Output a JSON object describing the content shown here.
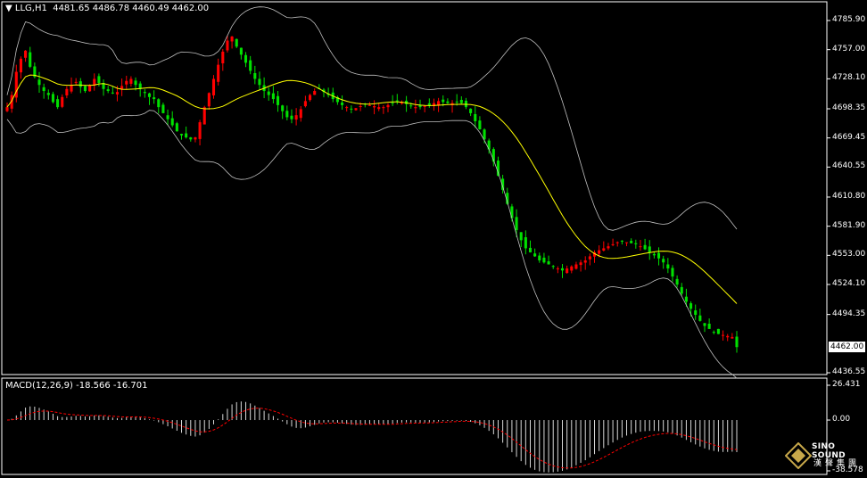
{
  "header": {
    "symbol": "LLG,H1",
    "ohlc": "4481.65 4486.78 4460.49 4462.00",
    "macd_label": "MACD(12,26,9) -18.566 -16.701"
  },
  "price_axis": {
    "ticks": [
      "4785.90",
      "4757.00",
      "4728.10",
      "4698.35",
      "4669.45",
      "4640.55",
      "4610.80",
      "4581.90",
      "4553.00",
      "4524.10",
      "4494.35",
      "4436.55"
    ],
    "current_price": "4462.00"
  },
  "macd_axis": {
    "ticks": [
      "26.431",
      "0.00",
      "-38.578"
    ]
  },
  "logo": {
    "en": "SINO SOUND",
    "cn": "漢聲集團"
  },
  "colors": {
    "up": "#ff0000",
    "down": "#00e000",
    "ma": "#ffff00",
    "bands": "#c0c0c0",
    "signal": "#ff0000"
  },
  "chart_data": [
    {
      "type": "candlestick",
      "title": "LLG,H1",
      "ylim": [
        4430,
        4800
      ],
      "overlays": [
        "Bollinger Bands",
        "Moving Average"
      ],
      "close": [
        4700,
        4712,
        4735,
        4748,
        4756,
        4740,
        4730,
        4722,
        4716,
        4712,
        4705,
        4700,
        4710,
        4718,
        4722,
        4725,
        4720,
        4716,
        4722,
        4728,
        4724,
        4718,
        4716,
        4714,
        4715,
        4721,
        4726,
        4728,
        4722,
        4718,
        4714,
        4710,
        4708,
        4700,
        4694,
        4688,
        4682,
        4676,
        4672,
        4670,
        4668,
        4670,
        4685,
        4700,
        4714,
        4728,
        4742,
        4755,
        4766,
        4770,
        4760,
        4752,
        4744,
        4736,
        4728,
        4722,
        4716,
        4712,
        4708,
        4702,
        4696,
        4690,
        4688,
        4692,
        4698,
        4706,
        4712,
        4716,
        4718,
        4715,
        4712,
        4708,
        4705,
        4702,
        4700,
        4698,
        4699,
        4701,
        4703,
        4702,
        4701,
        4700,
        4700,
        4702,
        4704,
        4706,
        4705,
        4703,
        4701,
        4700,
        4700,
        4701,
        4702,
        4704,
        4706,
        4705,
        4704,
        4704,
        4705,
        4704,
        4700,
        4694,
        4686,
        4678,
        4668,
        4658,
        4646,
        4632,
        4618,
        4604,
        4590,
        4578,
        4568,
        4560,
        4556,
        4552,
        4548,
        4546,
        4544,
        4542,
        4540,
        4538,
        4540,
        4542,
        4544,
        4546,
        4548,
        4552,
        4556,
        4558,
        4560,
        4562,
        4564,
        4566,
        4567,
        4566,
        4565,
        4564,
        4562,
        4559,
        4556,
        4553,
        4550,
        4546,
        4540,
        4532,
        4524,
        4515,
        4507,
        4500,
        4494,
        4488,
        4483,
        4480,
        4477,
        4475,
        4474,
        4473,
        4472,
        4462
      ]
    },
    {
      "type": "bar",
      "title": "MACD(12,26,9)",
      "values": {
        "macd": -18.566,
        "signal": -16.701
      },
      "ylim": [
        -38.578,
        26.431
      ]
    }
  ]
}
